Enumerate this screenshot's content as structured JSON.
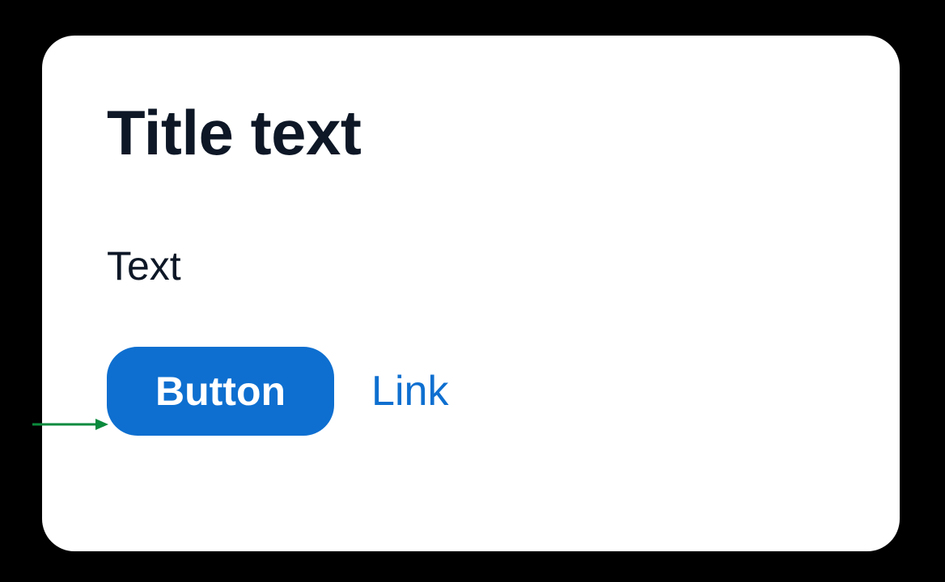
{
  "card": {
    "title": "Title text",
    "body": "Text",
    "button_label": "Button",
    "link_label": "Link"
  },
  "colors": {
    "primary": "#0e6fd0",
    "title": "#0d1726",
    "text": "#0d1726",
    "card_bg": "#ffffff",
    "backdrop": "#000000",
    "annotation": "#0a8a3c"
  }
}
